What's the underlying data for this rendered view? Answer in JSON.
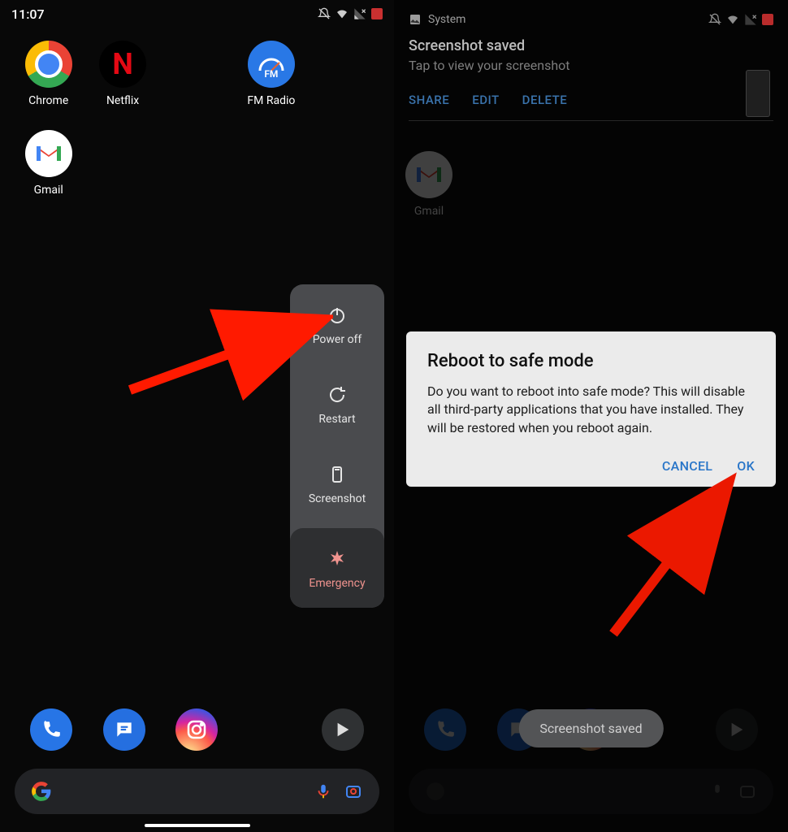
{
  "left": {
    "status": {
      "time": "11:07"
    },
    "apps": {
      "chrome": "Chrome",
      "netflix": "Netflix",
      "fmradio": "FM Radio",
      "gmail": "Gmail"
    },
    "power_menu": {
      "power_off": "Power off",
      "restart": "Restart",
      "screenshot": "Screenshot",
      "emergency": "Emergency"
    }
  },
  "right": {
    "status": {
      "app": "System"
    },
    "apps": {
      "gmail": "Gmail"
    },
    "notification": {
      "title": "Screenshot saved",
      "subtitle": "Tap to view your screenshot",
      "actions": {
        "share": "SHARE",
        "edit": "EDIT",
        "delete": "DELETE"
      }
    },
    "dialog": {
      "title": "Reboot to safe mode",
      "body": "Do you want to reboot into safe mode? This will disable all third-party applications that you have installed. They will be restored when you reboot again.",
      "cancel": "CANCEL",
      "ok": "OK"
    },
    "toast": "Screenshot saved"
  }
}
